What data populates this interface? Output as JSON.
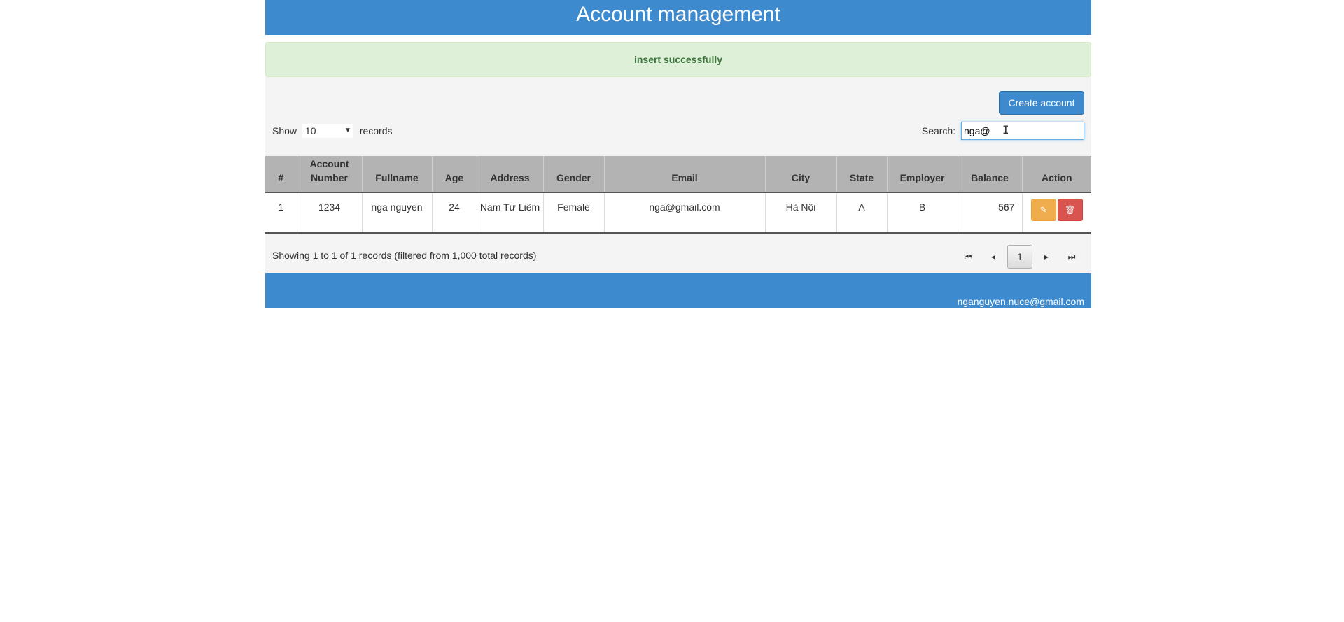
{
  "header": {
    "title": "Account management"
  },
  "alert": {
    "message": "insert successfully"
  },
  "toolbar": {
    "create_label": "Create account"
  },
  "length": {
    "show_label": "Show",
    "selected": "10",
    "records_label": "records"
  },
  "search": {
    "label": "Search:",
    "value": "nga@"
  },
  "table": {
    "headers": {
      "index": "#",
      "account_number": "Account Number",
      "fullname": "Fullname",
      "age": "Age",
      "address": "Address",
      "gender": "Gender",
      "email": "Email",
      "city": "City",
      "state": "State",
      "employer": "Employer",
      "balance": "Balance",
      "action": "Action"
    },
    "rows": [
      {
        "index": "1",
        "account_number": "1234",
        "fullname": "nga nguyen",
        "age": "24",
        "address": "Nam Từ Liêm",
        "gender": "Female",
        "email": "nga@gmail.com",
        "city": "Hà Nội",
        "state": "A",
        "employer": "B",
        "balance": "567",
        "edit_icon": "edit-icon",
        "delete_icon": "trash-icon"
      }
    ]
  },
  "status": {
    "text": "Showing 1 to 1 of 1 records (filtered from 1,000 total records)"
  },
  "pagination": {
    "first_glyph": "⏮",
    "prev_glyph": "◂",
    "current_page": "1",
    "next_glyph": "▸",
    "last_glyph": "⏭"
  },
  "footer": {
    "email": "nganguyen.nuce@gmail.com"
  },
  "colors": {
    "brand": "#3d8bce",
    "alert_bg": "#dff0d8",
    "alert_text": "#3c763d",
    "edit": "#f0ad4e",
    "delete": "#d9534f",
    "table_header": "#b3b3b3"
  }
}
